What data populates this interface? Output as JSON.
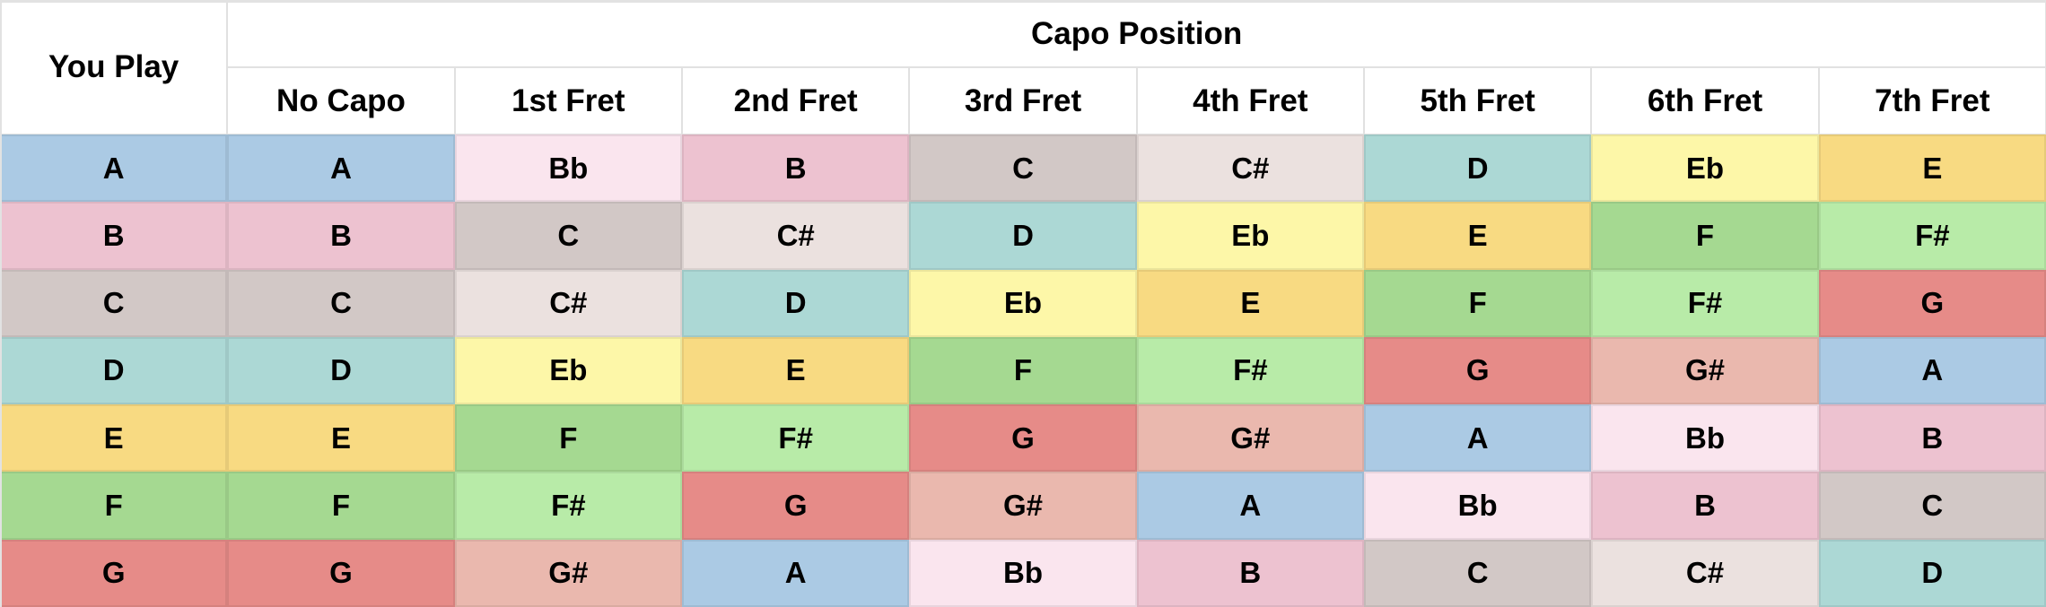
{
  "table": {
    "row_header_label": "You Play",
    "group_header_label": "Capo Position",
    "columns": [
      "No Capo",
      "1st Fret",
      "2nd Fret",
      "3rd Fret",
      "4th Fret",
      "5th Fret",
      "6th Fret",
      "7th Fret"
    ],
    "rows": [
      {
        "you_play": "A",
        "values": [
          "A",
          "Bb",
          "B",
          "C",
          "C#",
          "D",
          "Eb",
          "E"
        ]
      },
      {
        "you_play": "B",
        "values": [
          "B",
          "C",
          "C#",
          "D",
          "Eb",
          "E",
          "F",
          "F#"
        ]
      },
      {
        "you_play": "C",
        "values": [
          "C",
          "C#",
          "D",
          "Eb",
          "E",
          "F",
          "F#",
          "G"
        ]
      },
      {
        "you_play": "D",
        "values": [
          "D",
          "Eb",
          "E",
          "F",
          "F#",
          "G",
          "G#",
          "A"
        ]
      },
      {
        "you_play": "E",
        "values": [
          "E",
          "F",
          "F#",
          "G",
          "G#",
          "A",
          "Bb",
          "B"
        ]
      },
      {
        "you_play": "F",
        "values": [
          "F",
          "F#",
          "G",
          "G#",
          "A",
          "Bb",
          "B",
          "C"
        ]
      },
      {
        "you_play": "G",
        "values": [
          "G",
          "G#",
          "A",
          "Bb",
          "B",
          "C",
          "C#",
          "D"
        ]
      }
    ]
  },
  "note_colors": {
    "A": "#abcae4",
    "Bb": "#fae5ee",
    "B": "#edc2d0",
    "C": "#d2c8c6",
    "C#": "#ebe1df",
    "D": "#acd8d5",
    "Eb": "#fdf7a8",
    "E": "#f8da82",
    "F": "#a5d991",
    "F#": "#b8eba8",
    "G": "#e68b88",
    "G#": "#eab8ae"
  }
}
